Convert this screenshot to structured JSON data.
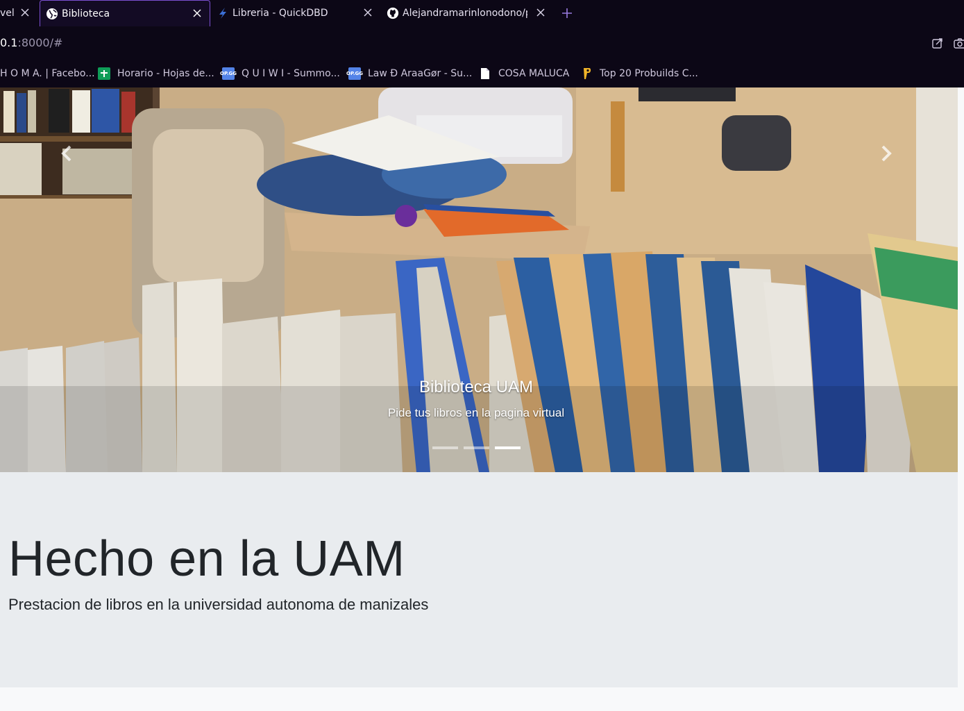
{
  "tabs": [
    {
      "label": "vel",
      "favicon": "page-icon",
      "active": false
    },
    {
      "label": "Biblioteca",
      "favicon": "globe-icon",
      "active": true
    },
    {
      "label": "Libreria - QuickDBD",
      "favicon": "lightning-icon",
      "active": false
    },
    {
      "label": "Alejandramarinlonodono/p",
      "favicon": "github-icon",
      "active": false
    }
  ],
  "address_bar": {
    "url_prefix": "0.1",
    "url_rest": ":8000/#"
  },
  "bookmarks": [
    {
      "label": "H O M A. | Facebo...",
      "icon": "facebook-icon"
    },
    {
      "label": "Horario - Hojas de...",
      "icon": "sheets-icon",
      "color": "#0f9d58"
    },
    {
      "label": "Q U I W I - Summo...",
      "icon": "opgg-icon",
      "icon_text": "OP.GG",
      "color": "#5383e8"
    },
    {
      "label": "Law Ð AraaGør - Su...",
      "icon": "opgg-icon",
      "icon_text": "OP.GG",
      "color": "#5383e8"
    },
    {
      "label": "COSA MALUCA",
      "icon": "document-icon"
    },
    {
      "label": "Top 20 Probuilds C...",
      "icon": "probuilds-icon",
      "color": "#f0b429"
    }
  ],
  "carousel": {
    "title": "Biblioteca UAM",
    "text": "Pide tus libros en la pagina virtual",
    "slides": 3,
    "active_slide": 3
  },
  "jumbotron": {
    "heading": "Hecho en la UAM",
    "lead": "Prestacion de libros en la universidad autonoma de manizales"
  },
  "colors": {
    "chrome_bg": "#0c0716",
    "tab_active_border": "#7b4fd0",
    "jumbotron_bg": "#e9ecef",
    "page_bg": "#f8f9fa"
  }
}
